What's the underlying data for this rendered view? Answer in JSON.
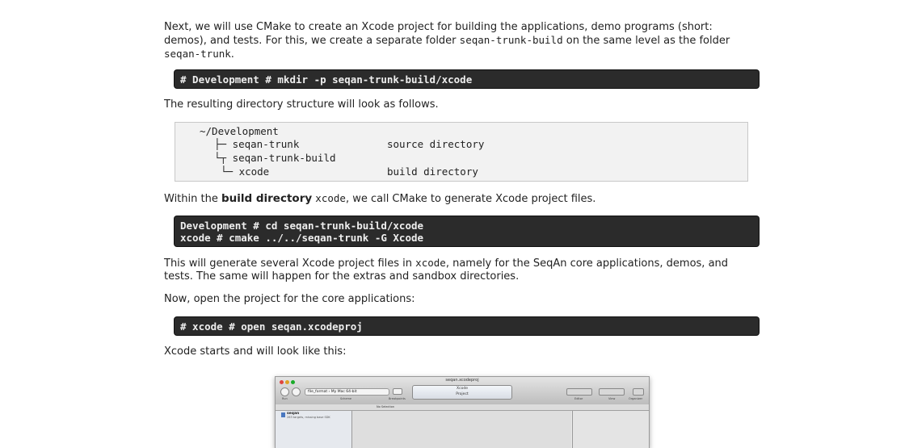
{
  "para1": {
    "t1": "Next, we will use CMake to create an Xcode project for building the applications, demo programs (short: demos), and tests. For this, we create a separate folder ",
    "code1": "seqan-trunk-build",
    "t2": " on the same level as the folder ",
    "code2": "seqan-trunk",
    "t3": "."
  },
  "cmd1": "# Development # mkdir -p seqan-trunk-build/xcode",
  "para2": "The resulting directory structure will look as follows.",
  "tree": {
    "line1": "~/Development",
    "line2": "├─ seqan-trunk",
    "line2_desc": "source directory",
    "line3": "└┬ seqan-trunk-build",
    "line4": "└─ xcode",
    "line4_desc": "build directory"
  },
  "para3": {
    "t1": "Within the ",
    "bold": "build directory",
    "code": "xcode",
    "t2": ", we call CMake to generate Xcode project files."
  },
  "cmd2": {
    "line1": "Development # cd seqan-trunk-build/xcode",
    "line2": "xcode # cmake ../../seqan-trunk -G Xcode"
  },
  "para4": {
    "t1": "This will generate several Xcode project files in ",
    "code": "xcode",
    "t2": ", namely for the SeqAn core applications, demos, and tests. The same will happen for the extras and sandbox directories."
  },
  "para5": "Now, open the project for the core applications:",
  "cmd3": "# xcode # open seqan.xcodeproj",
  "para6": "Xcode starts and will look like this:",
  "xcode_screenshot": {
    "window_title": "seqan.xcodeproj",
    "scheme": "file_format › My Mac 64-bit",
    "activity_title": "Xcode",
    "activity_sub": "Project",
    "label_run": "Run",
    "label_scheme": "Scheme",
    "label_breakpoints": "Breakpoints",
    "label_editor": "Editor",
    "label_view": "View",
    "label_organizer": "Organizer",
    "jump_bar": "No Selection",
    "nav_project": "seqan",
    "nav_project_sub": "263 targets, missing base SDK"
  }
}
